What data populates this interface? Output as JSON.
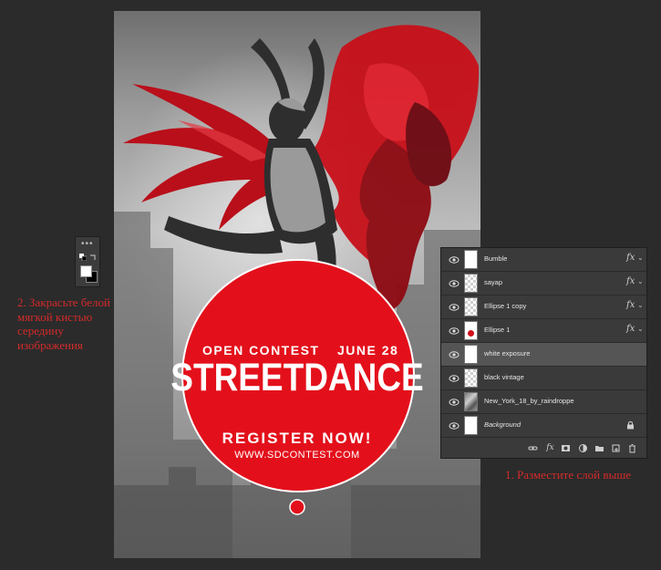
{
  "poster": {
    "open_contest": "OPEN CONTEST",
    "date": "JUNE 28",
    "title": "STREETDANCE",
    "register": "REGISTER NOW!",
    "url": "WWW.SDCONTEST.COM",
    "accent_color": "#e3101b"
  },
  "annotations": {
    "left_note": "2. Закрасьте белой мягкой кистью середину изображения",
    "right_note": "1. Разместите слой выше"
  },
  "layers_panel": {
    "layers": [
      {
        "name": "Bumble",
        "thumb": "clip",
        "fx": "fx",
        "selected": false
      },
      {
        "name": "sayap",
        "thumb": "checker",
        "fx": "fx",
        "selected": false
      },
      {
        "name": "Ellipse 1 copy",
        "thumb": "checker",
        "fx": "fx",
        "selected": false
      },
      {
        "name": "Ellipse 1",
        "thumb": "ellipse",
        "fx": "fx",
        "selected": false
      },
      {
        "name": "white exposure",
        "thumb": "white",
        "fx": "",
        "selected": true
      },
      {
        "name": "black vintage",
        "thumb": "checker",
        "fx": "",
        "selected": false
      },
      {
        "name": "New_York_18_by_raindroppe",
        "thumb": "photo",
        "fx": "",
        "selected": false
      },
      {
        "name": "Background",
        "thumb": "white",
        "fx": "",
        "selected": false,
        "locked": true
      }
    ],
    "footer_icons": [
      "link-icon",
      "fx-icon",
      "mask-icon",
      "adjustment-icon",
      "folder-icon",
      "new-layer-icon",
      "trash-icon"
    ]
  },
  "tool_palette": {
    "foreground_color": "#ffffff",
    "background_color": "#000000"
  }
}
